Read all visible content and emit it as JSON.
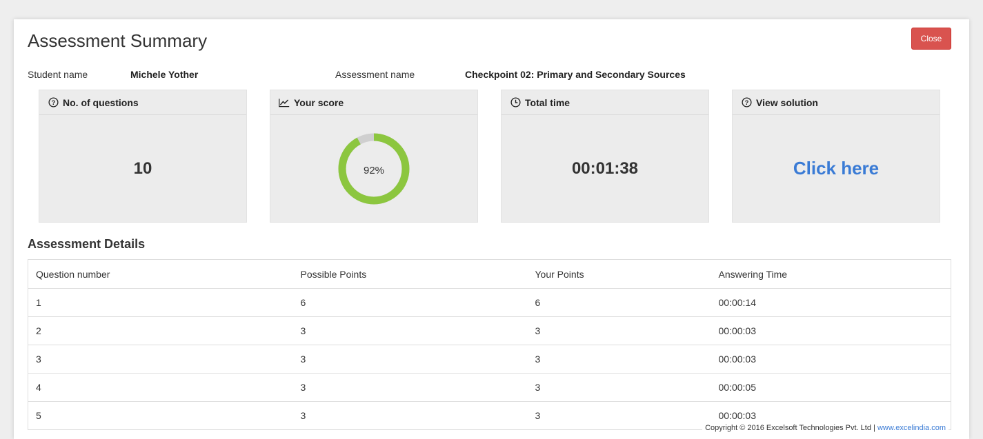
{
  "title": "Assessment Summary",
  "close_label": "Close",
  "student": {
    "label": "Student name",
    "value": "Michele Yother"
  },
  "assessment": {
    "label": "Assessment name",
    "value": "Checkpoint 02: Primary and Secondary Sources"
  },
  "cards": {
    "questions": {
      "label": "No. of questions",
      "icon": "question-circle-icon",
      "value": "10"
    },
    "score": {
      "label": "Your score",
      "icon": "line-chart-icon",
      "value": "92%",
      "percent": 92
    },
    "time": {
      "label": "Total time",
      "icon": "clock-icon",
      "value": "00:01:38"
    },
    "solution": {
      "label": "View solution",
      "icon": "question-circle-icon",
      "link": "Click here"
    }
  },
  "details": {
    "title": "Assessment Details",
    "columns": [
      "Question number",
      "Possible Points",
      "Your Points",
      "Answering Time"
    ],
    "rows": [
      [
        "1",
        "6",
        "6",
        "00:00:14"
      ],
      [
        "2",
        "3",
        "3",
        "00:00:03"
      ],
      [
        "3",
        "3",
        "3",
        "00:00:03"
      ],
      [
        "4",
        "3",
        "3",
        "00:00:05"
      ],
      [
        "5",
        "3",
        "3",
        "00:00:03"
      ]
    ]
  },
  "footer": {
    "copyright": "Copyright © 2016 Excelsoft Technologies Pvt. Ltd |",
    "link": "www.excelindia.com"
  },
  "colors": {
    "accent_green": "#8cc63f",
    "donut_track": "#cfcfcf",
    "close_red": "#d9534f",
    "link_blue": "#3a7bd5"
  }
}
